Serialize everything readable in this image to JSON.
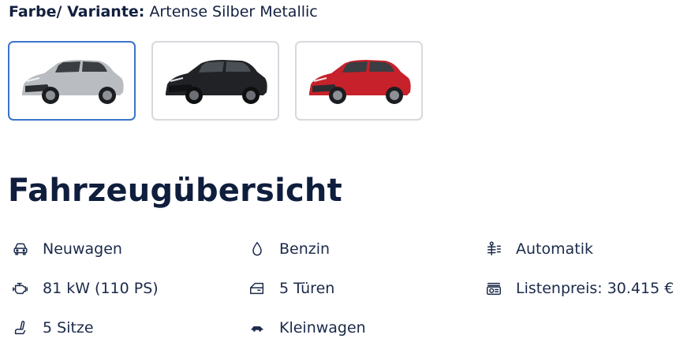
{
  "variant": {
    "label": "Farbe/ Variante:",
    "value": "Artense Silber Metallic"
  },
  "swatches": [
    {
      "name": "Artense Silber Metallic",
      "color": "#b9bcc0",
      "selected": true
    },
    {
      "name": "Schwarz",
      "color": "#202225",
      "selected": false
    },
    {
      "name": "Rot",
      "color": "#c7212b",
      "selected": false
    }
  ],
  "overview": {
    "title": "Fahrzeugübersicht",
    "features": [
      {
        "icon": "car-front-icon",
        "label": "Neuwagen"
      },
      {
        "icon": "fuel-drop-icon",
        "label": "Benzin"
      },
      {
        "icon": "gear-shift-icon",
        "label": "Automatik"
      },
      {
        "icon": "engine-icon",
        "label": "81 kW (110 PS)"
      },
      {
        "icon": "car-door-icon",
        "label": "5 Türen"
      },
      {
        "icon": "price-tag-icon",
        "label": "Listenpreis: 30.415 €"
      },
      {
        "icon": "car-seat-icon",
        "label": "5 Sitze"
      },
      {
        "icon": "small-car-icon",
        "label": "Kleinwagen"
      }
    ]
  }
}
